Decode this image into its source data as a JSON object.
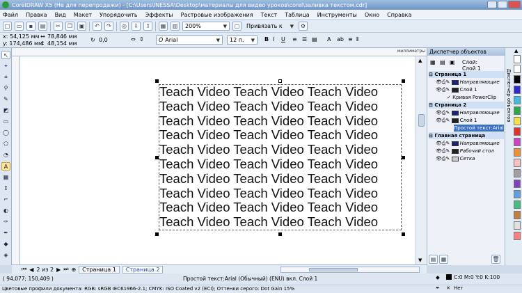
{
  "window": {
    "title": "CorelDRAW X5 (Не для перепродажи) - [C:\\Users\\INESSA\\Desktop\\материалы для видео уроков\\corel\\заливка текстом.cdr]"
  },
  "menu": [
    "Файл",
    "Правка",
    "Вид",
    "Макет",
    "Упорядочить",
    "Эффекты",
    "Растровые изображения",
    "Текст",
    "Таблица",
    "Инструменты",
    "Окно",
    "Справка"
  ],
  "toolbar": {
    "zoom": "200%",
    "snap_label": "Привязать к"
  },
  "propbar": {
    "x": "x: 54,125 мм",
    "y": "y: 174,486 мм",
    "w": "78,846 мм",
    "h": "48,154 мм",
    "angle": "0,0",
    "font": "Arial",
    "font_size": "12 п."
  },
  "ruler": {
    "unit": "миллиметры"
  },
  "canvas": {
    "text_lines": [
      "Teach Video Teach Video Teach Video",
      "Teach Video Teach Video Teach Video",
      "Teach Video Teach Video Teach Video",
      "Teach Video Teach Video Teach Video",
      "Teach Video Teach Video Teach Video",
      "Teach Video Teach Video Teach Video",
      "Teach Video Teach Video Teach Video",
      "Teach Video Teach Video Teach Video",
      "Teach Video Teach Video Teach Video",
      "Teach Video Teach Video Teach Video",
      "Teach Video Teach Video Teach Video"
    ]
  },
  "docker": {
    "title": "Диспетчер объектов",
    "layer_label": "Слой:",
    "layer_value": "Слой 1",
    "rows": [
      {
        "label": "Страница 1",
        "kind": "page"
      },
      {
        "label": "Направляющие",
        "kind": "item",
        "color": "#1a237e"
      },
      {
        "label": "Слой 1",
        "kind": "item",
        "color": "#222222"
      },
      {
        "label": "Кривая PowerClip",
        "kind": "sub"
      },
      {
        "label": "Страница 2",
        "kind": "page"
      },
      {
        "label": "Направляющие",
        "kind": "item",
        "color": "#1a237e"
      },
      {
        "label": "Слой 1",
        "kind": "item",
        "color": "#222222"
      },
      {
        "label": "Простой текст:Arial",
        "kind": "sel"
      },
      {
        "label": "Главная страница",
        "kind": "page"
      },
      {
        "label": "Направляющие",
        "kind": "item",
        "color": "#1a237e"
      },
      {
        "label": "Рабочий стол",
        "kind": "item",
        "color": "#222222"
      },
      {
        "label": "Сетка",
        "kind": "item",
        "color": "#cccccc"
      }
    ],
    "side_tab": "Диспетчер объектов"
  },
  "palette": [
    "#ffffff",
    "#000000",
    "#2a2ad0",
    "#3dbde0",
    "#2aa84a",
    "#f0e040",
    "#e03030",
    "#d040c0",
    "#f09030",
    "#f5c0c0",
    "#a0a0a0",
    "#8040c0",
    "#60a0e0",
    "#40c080",
    "#c08040",
    "#e0e0e0",
    "#ff8080"
  ],
  "pagenav": {
    "counter": "2 из 2",
    "tab1": "Страница 1",
    "tab2": "Страница 2"
  },
  "status": {
    "coords": "( 94,077; 150,409 )",
    "object": "Простой текст:Arial (Обычный) (ENU) вкл. Слой 1",
    "color_profile": "Цветовые профили документа: RGB: sRGB IEC61966-2.1; CMYK: ISO Coated v2 (ECI); Оттенки серого: Dot Gain 15%",
    "fill": "C:0 M:0 Y:0 K:100",
    "outline": "Нет"
  },
  "colors": {
    "accent": "#3a6fc8",
    "title_bar": "#6f93c4"
  }
}
